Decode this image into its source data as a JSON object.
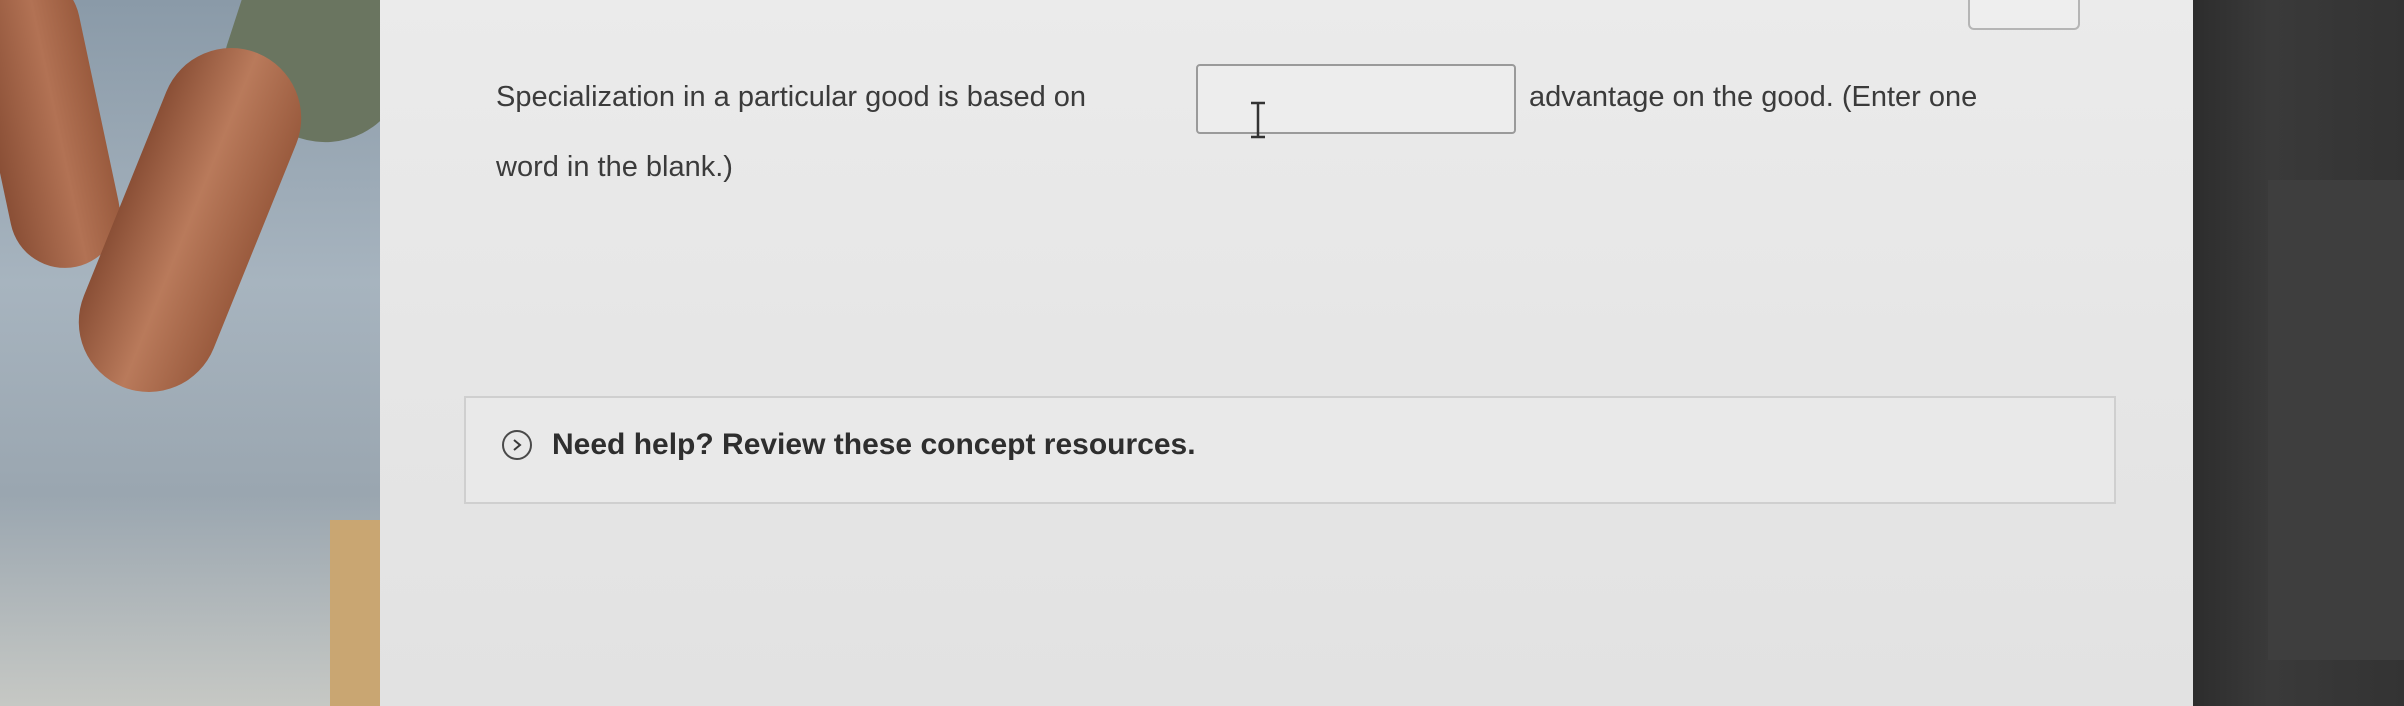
{
  "question": {
    "text_before": "Specialization in a particular good is based on",
    "text_after": "advantage on the good. (Enter one",
    "text_line2": "word in the blank.)",
    "answer_value": "",
    "answer_placeholder": ""
  },
  "help": {
    "label": "Need help? Review these concept resources.",
    "icon": "chevron-right-circle-icon"
  },
  "colors": {
    "sheet_background": "#e6e6e6",
    "text": "#3b3b3b",
    "panel_border": "#cfcfcf"
  }
}
